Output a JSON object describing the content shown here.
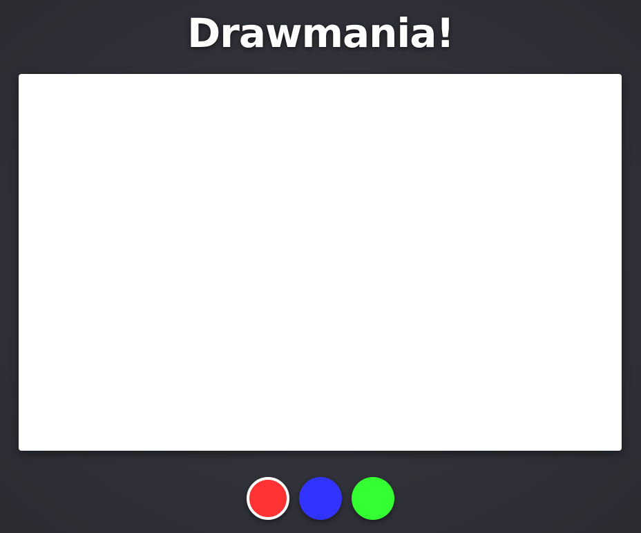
{
  "app": {
    "title": "Drawmania!"
  },
  "canvas": {
    "background": "#ffffff"
  },
  "palette": {
    "selected": "red",
    "colors": [
      {
        "id": "red",
        "hex": "#ff3333"
      },
      {
        "id": "blue",
        "hex": "#3333ff"
      },
      {
        "id": "green",
        "hex": "#33ff33"
      }
    ]
  }
}
